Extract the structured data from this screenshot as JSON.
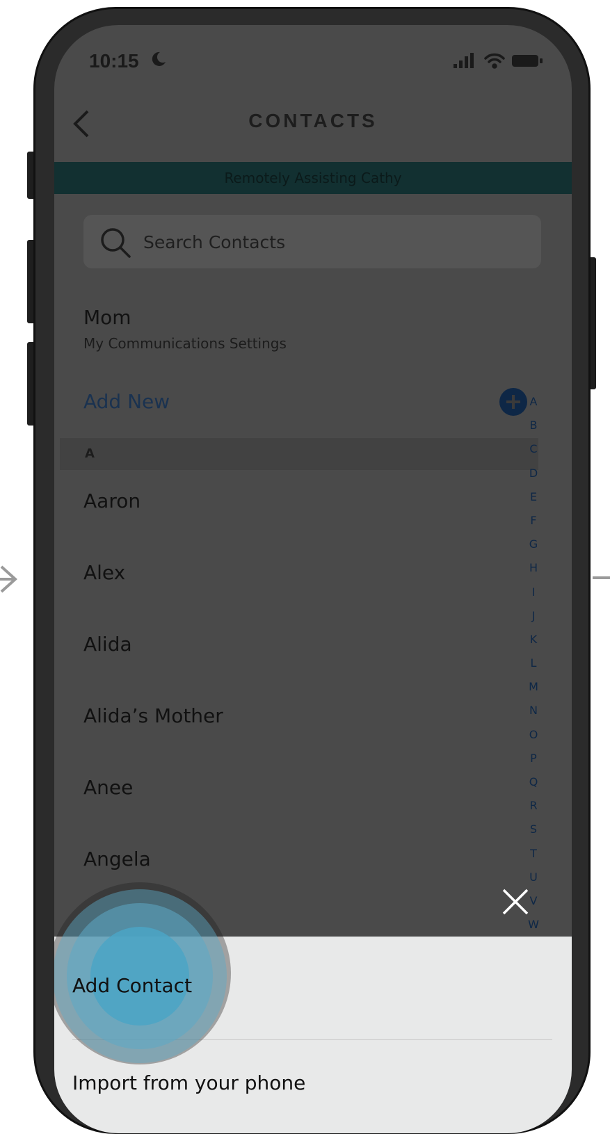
{
  "status_bar": {
    "time": "10:15"
  },
  "header": {
    "title": "CONTACTS"
  },
  "banner": {
    "text": "Remotely Assisting Cathy"
  },
  "search": {
    "placeholder": "Search Contacts"
  },
  "my_card": {
    "name": "Mom",
    "subtitle": "My Communications Settings"
  },
  "add_new": {
    "label": "Add New"
  },
  "section": {
    "label": "A"
  },
  "contacts": [
    "Aaron",
    "Alex",
    "Alida",
    "Alida’s Mother",
    "Anee",
    "Angela"
  ],
  "alphabet": [
    "A",
    "B",
    "C",
    "D",
    "E",
    "F",
    "G",
    "H",
    "I",
    "J",
    "K",
    "L",
    "M",
    "N",
    "O",
    "P",
    "Q",
    "R",
    "S",
    "T",
    "U",
    "V",
    "W"
  ],
  "sheet": {
    "add_contact": "Add Contact",
    "import": "Import from your phone"
  },
  "colors": {
    "banner_bg": "#123031",
    "accent": "#0e2746",
    "tap_highlight": "#5daac7"
  }
}
